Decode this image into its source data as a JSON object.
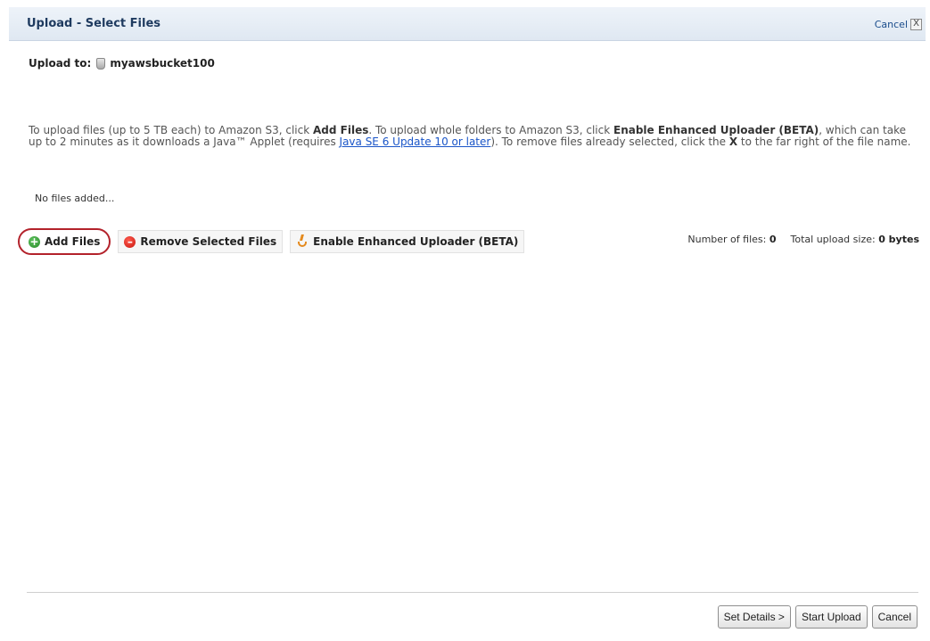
{
  "dialog": {
    "title": "Upload - Select Files",
    "cancel_link": "Cancel",
    "close_glyph": "X"
  },
  "upload_to": {
    "label": "Upload to:",
    "bucket_icon": "bucket-icon",
    "bucket_name": "myawsbucket100"
  },
  "instructions": {
    "part1": "To upload files (up to 5 TB each) to Amazon S3, click ",
    "add_files": "Add Files",
    "part2": ". To upload whole folders to Amazon S3, click ",
    "enable_enhanced": "Enable Enhanced Uploader (BETA)",
    "part3": ", which can take up to 2 minutes as it downloads a Java™ Applet (requires ",
    "java_link": "Java SE 6 Update 10 or later",
    "part4": "). To remove files already selected, click the ",
    "x": "X",
    "part5": " to the far right of the file name."
  },
  "file_list": {
    "empty_message": "No files added..."
  },
  "toolbar": {
    "add_files": "Add Files",
    "remove_selected": "Remove Selected Files",
    "enable_enhanced": "Enable Enhanced Uploader (BETA)",
    "icons": [
      "add-icon",
      "remove-icon",
      "java-icon"
    ],
    "highlight_color": "#b3222b"
  },
  "summary": {
    "files_label": "Number of files:",
    "files_count": "0",
    "size_label": "Total upload size:",
    "size_value": "0 bytes"
  },
  "footer": {
    "set_details": "Set Details >",
    "start_upload": "Start Upload",
    "cancel": "Cancel"
  }
}
